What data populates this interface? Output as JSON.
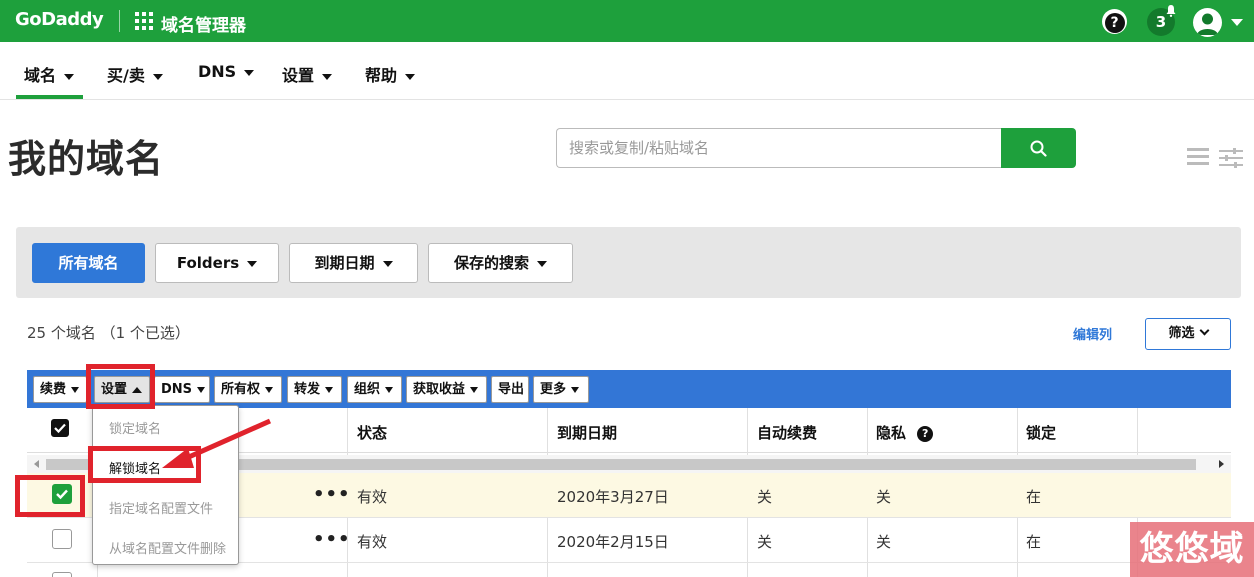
{
  "topbar": {
    "logo": "GoDaddy",
    "app_title": "域名管理器",
    "notification_count": "3",
    "brand_color": "#1ea03c"
  },
  "nav": {
    "items": [
      {
        "label": "域名"
      },
      {
        "label": "买/卖"
      },
      {
        "label": "DNS"
      },
      {
        "label": "设置"
      },
      {
        "label": "帮助"
      }
    ],
    "active": "域名"
  },
  "page": {
    "title": "我的域名",
    "search_placeholder": "搜索或复制/粘贴域名"
  },
  "filters": {
    "all_domains": "所有域名",
    "folders": "Folders",
    "expiry_date": "到期日期",
    "saved_searches": "保存的搜索"
  },
  "summary": {
    "count_text": "25 个域名 （1 个已选）",
    "edit_columns": "编辑列",
    "filter": "筛选"
  },
  "toolbar": {
    "renew": "续费",
    "settings": "设置",
    "dns": "DNS",
    "ownership": "所有权",
    "forwarding": "转发",
    "organize": "组织",
    "monetize": "获取收益",
    "export": "导出",
    "more": "更多"
  },
  "settings_menu": {
    "items": [
      {
        "label": "锁定域名",
        "enabled": false
      },
      {
        "label": "解锁域名",
        "enabled": true
      },
      {
        "label": "指定域名配置文件",
        "enabled": false
      },
      {
        "label": "从域名配置文件删除",
        "enabled": false
      }
    ]
  },
  "table": {
    "headers": {
      "status": "状态",
      "expiry": "到期日期",
      "auto_renew": "自动续费",
      "privacy": "隐私",
      "lock": "锁定"
    },
    "rows": [
      {
        "selected": true,
        "actions": "•••",
        "status": "有效",
        "expiry": "2020年3月27日",
        "auto_renew": "关",
        "privacy": "关",
        "lock": "在"
      },
      {
        "selected": false,
        "actions": "•••",
        "status": "有效",
        "expiry": "2020年2月15日",
        "auto_renew": "关",
        "privacy": "关",
        "lock": "在"
      }
    ]
  },
  "watermark": "悠悠域名",
  "colors": {
    "toolbar_blue": "#3376d6",
    "primary_button": "#2f78d8",
    "annotation_red": "#e0232c",
    "selected_row": "#fdf9e3"
  }
}
